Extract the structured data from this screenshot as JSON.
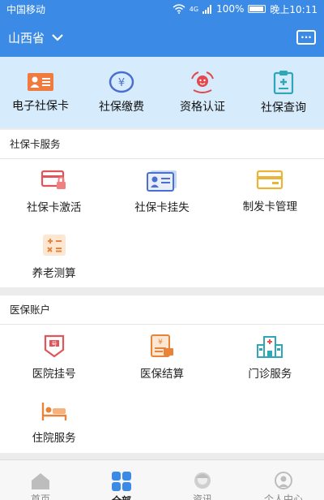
{
  "status_bar": {
    "carrier": "中国移动",
    "network": "4G",
    "battery": "100%",
    "time": "晚上10:11"
  },
  "header": {
    "region": "山西省",
    "message_icon": "chat-icon"
  },
  "quick_actions": [
    {
      "label": "电子社保卡",
      "icon": "id-card-icon",
      "color": "#f07b3f"
    },
    {
      "label": "社保缴费",
      "icon": "yuan-icon",
      "color": "#4a6fd1"
    },
    {
      "label": "资格认证",
      "icon": "face-verify-icon",
      "color": "#e5484d"
    },
    {
      "label": "社保查询",
      "icon": "clipboard-icon",
      "color": "#2fa7b8"
    }
  ],
  "card_services": {
    "title": "社保卡服务",
    "items": [
      {
        "label": "社保卡激活",
        "icon": "card-lock-icon"
      },
      {
        "label": "社保卡挂失",
        "icon": "card-report-icon"
      },
      {
        "label": "制发卡管理",
        "icon": "card-manage-icon"
      },
      {
        "label": "养老测算",
        "icon": "calculator-icon"
      }
    ]
  },
  "medical_account": {
    "title": "医保账户",
    "items": [
      {
        "label": "医院挂号",
        "icon": "registration-icon"
      },
      {
        "label": "医保结算",
        "icon": "settlement-icon"
      },
      {
        "label": "门诊服务",
        "icon": "hospital-icon"
      },
      {
        "label": "住院服务",
        "icon": "bed-icon"
      }
    ]
  },
  "tab_bar": [
    {
      "label": "首页",
      "icon": "home-icon",
      "active": false
    },
    {
      "label": "全部",
      "icon": "grid-icon",
      "active": true
    },
    {
      "label": "资讯",
      "icon": "news-icon",
      "active": false
    },
    {
      "label": "个人中心",
      "icon": "user-icon",
      "active": false
    }
  ],
  "colors": {
    "primary": "#3b8be6",
    "quick_bg": "#d6ebfb"
  }
}
